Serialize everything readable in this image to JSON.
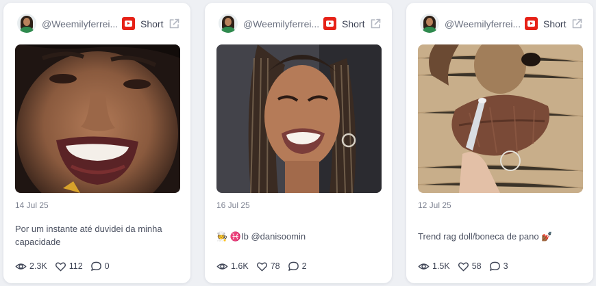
{
  "cards": [
    {
      "handle": "@Weemilyferrei...",
      "platform_label": "Short",
      "date": "14 Jul 25",
      "caption": "Por um instante até duvidei da minha capacidade",
      "views": "2.3K",
      "likes": "112",
      "comments": "0"
    },
    {
      "handle": "@Weemilyferrei...",
      "platform_label": "Short",
      "date": "16 Jul 25",
      "caption": "🧑‍🍳 ♓️Ib @danisoomin",
      "views": "1.6K",
      "likes": "78",
      "comments": "2"
    },
    {
      "handle": "@Weemilyferrei...",
      "platform_label": "Short",
      "date": "12 Jul 25",
      "caption": "Trend rag doll/boneca de pano 💅🏾",
      "views": "1.5K",
      "likes": "58",
      "comments": "3"
    }
  ],
  "colors": {
    "background": "#eef0f4",
    "card": "#ffffff",
    "youtube_red": "#e62117",
    "text_primary": "#3d4354",
    "text_muted": "#7d8291"
  },
  "icons": [
    "avatar",
    "youtube-icon",
    "external-link-icon",
    "eye-icon",
    "heart-icon",
    "comment-icon"
  ]
}
